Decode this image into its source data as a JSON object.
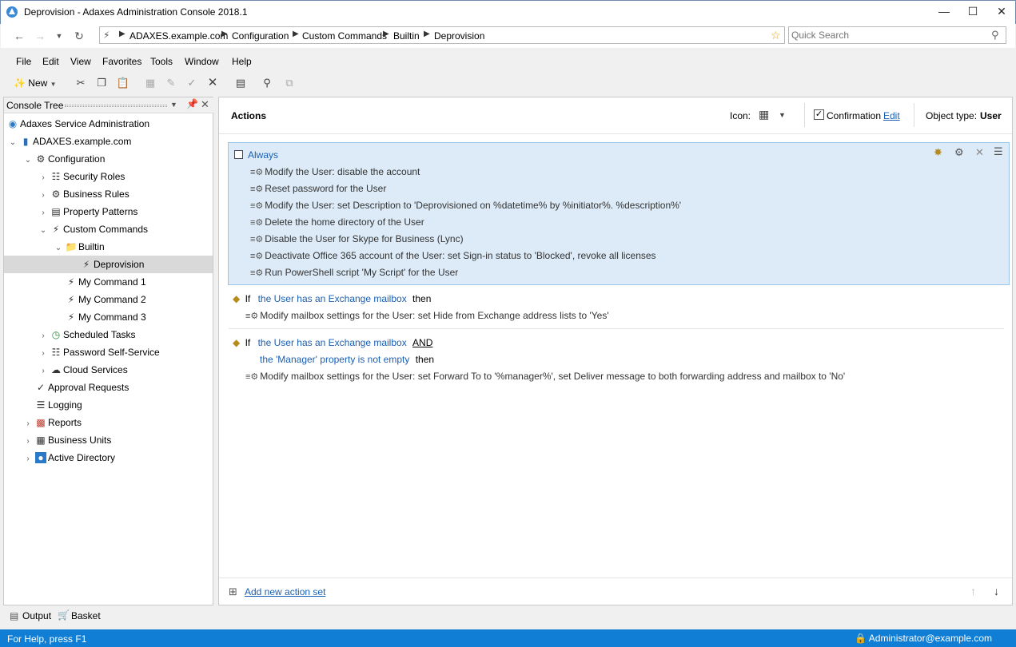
{
  "window": {
    "title": "Deprovision - Adaxes Administration Console 2018.1",
    "minimize_glyph": "—",
    "maximize_glyph": "☐",
    "close_glyph": "✕"
  },
  "address_bar": {
    "crumbs": [
      "ADAXES.example.com",
      "Configuration",
      "Custom Commands",
      "Builtin",
      "Deprovision"
    ]
  },
  "search": {
    "placeholder": "Quick Search"
  },
  "menu": [
    "File",
    "Edit",
    "View",
    "Favorites",
    "Tools",
    "Window",
    "Help"
  ],
  "toolbar": {
    "new_label": "New"
  },
  "console_tree": {
    "title": "Console Tree",
    "nodes": [
      {
        "label": "Adaxes Service Administration",
        "icon": "adaxes-icon"
      },
      {
        "label": "ADAXES.example.com",
        "icon": "server-icon"
      },
      {
        "label": "Configuration",
        "icon": "configuration-icon"
      },
      {
        "label": "Security Roles",
        "icon": "security-roles-icon"
      },
      {
        "label": "Business Rules",
        "icon": "business-rules-icon"
      },
      {
        "label": "Property Patterns",
        "icon": "property-patterns-icon"
      },
      {
        "label": "Custom Commands",
        "icon": "custom-commands-icon"
      },
      {
        "label": "Builtin",
        "icon": "folder-icon"
      },
      {
        "label": "Deprovision",
        "icon": "command-icon"
      },
      {
        "label": "My Command 1",
        "icon": "command-icon"
      },
      {
        "label": "My Command 2",
        "icon": "command-icon"
      },
      {
        "label": "My Command 3",
        "icon": "command-icon"
      },
      {
        "label": "Scheduled Tasks",
        "icon": "clock-icon"
      },
      {
        "label": "Password Self-Service",
        "icon": "password-icon"
      },
      {
        "label": "Cloud Services",
        "icon": "cloud-icon"
      },
      {
        "label": "Approval Requests",
        "icon": "approval-icon"
      },
      {
        "label": "Logging",
        "icon": "logging-icon"
      },
      {
        "label": "Reports",
        "icon": "reports-icon"
      },
      {
        "label": "Business Units",
        "icon": "business-units-icon"
      },
      {
        "label": "Active Directory",
        "icon": "active-directory-icon"
      }
    ]
  },
  "actions_panel": {
    "header": "Actions",
    "icon_label": "Icon:",
    "confirmation_label": "Confirmation",
    "edit_label": "Edit",
    "object_type_label": "Object type:",
    "object_type_value": "User",
    "always_label": "Always",
    "always_actions": [
      "Modify the User: disable the account",
      "Reset password for the User",
      "Modify the User: set Description to 'Deprovisioned on %datetime% by %initiator%. %description%'",
      "Delete the home directory of the User",
      "Disable the User for Skype for Business (Lync)",
      "Deactivate Office 365 account of the User: set Sign-in status to 'Blocked', revoke all licenses",
      "Run PowerShell script 'My Script' for the User"
    ],
    "if_keyword": "If",
    "then_keyword": "then",
    "and_keyword": "AND",
    "condition1": "the User has an Exchange mailbox",
    "action1": "Modify mailbox settings for the User: set Hide from Exchange address lists to 'Yes'",
    "condition2a": "the User has an Exchange mailbox",
    "condition2b": "the 'Manager' property is not empty",
    "action2": "Modify mailbox settings for the User: set Forward To to '%manager%', set Deliver message to both forwarding address and mailbox to 'No'",
    "add_action_set": "Add new action set"
  },
  "bottom_tabs": [
    "Output",
    "Basket"
  ],
  "status": {
    "help": "For Help, press F1",
    "user": "Administrator@example.com"
  }
}
